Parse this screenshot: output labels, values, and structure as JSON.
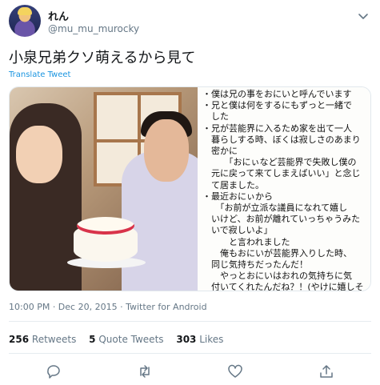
{
  "author": {
    "display_name": "れん",
    "handle": "@mu_mu_murocky"
  },
  "tweet": {
    "text": "小泉兄弟クソ萌えるから見て",
    "translate_label": "Translate Tweet"
  },
  "memo_lines": [
    "・僕は兄の事をおにいと呼んでいます",
    "・兄と僕は何をするにもずっと一緒で",
    "　した",
    "・兄が芸能界に入るため家を出て一人",
    "　暮らしする時、ぼくは寂しさのあまり",
    "　密かに",
    "　　　「おにぃなど芸能界で失敗し僕の",
    "　元に戻って来てしまえばいい」と念じ",
    "　て居ました。",
    "・最近おにぃから",
    "　　「お前が立派な議員になれて嬉し",
    "　いけど、お前が離れていっちゃうみた",
    "　いで寂しいよ」",
    "　　　と言われました",
    "　　俺もおにいが芸能界入りした時、",
    "　同じ気持ちだったんだ！",
    "　　やっとおにいはおれの気持ちに気",
    "　付いてくれたんだね？！(やけに嬉しそ"
  ],
  "meta": {
    "timestamp": "10:00 PM · Dec 20, 2015 · Twitter for Android"
  },
  "stats": {
    "retweets_count": "256",
    "retweets_label": "Retweets",
    "quote_count": "5",
    "quote_label": "Quote Tweets",
    "likes_count": "303",
    "likes_label": "Likes"
  },
  "icons": {
    "caret": "chevron-down-icon",
    "reply": "reply-icon",
    "retweet": "retweet-icon",
    "like": "heart-icon",
    "share": "share-icon"
  },
  "colors": {
    "link": "#1b95e0",
    "secondary_text": "#657786",
    "primary_text": "#14171a",
    "divider": "#e6ecf0"
  }
}
